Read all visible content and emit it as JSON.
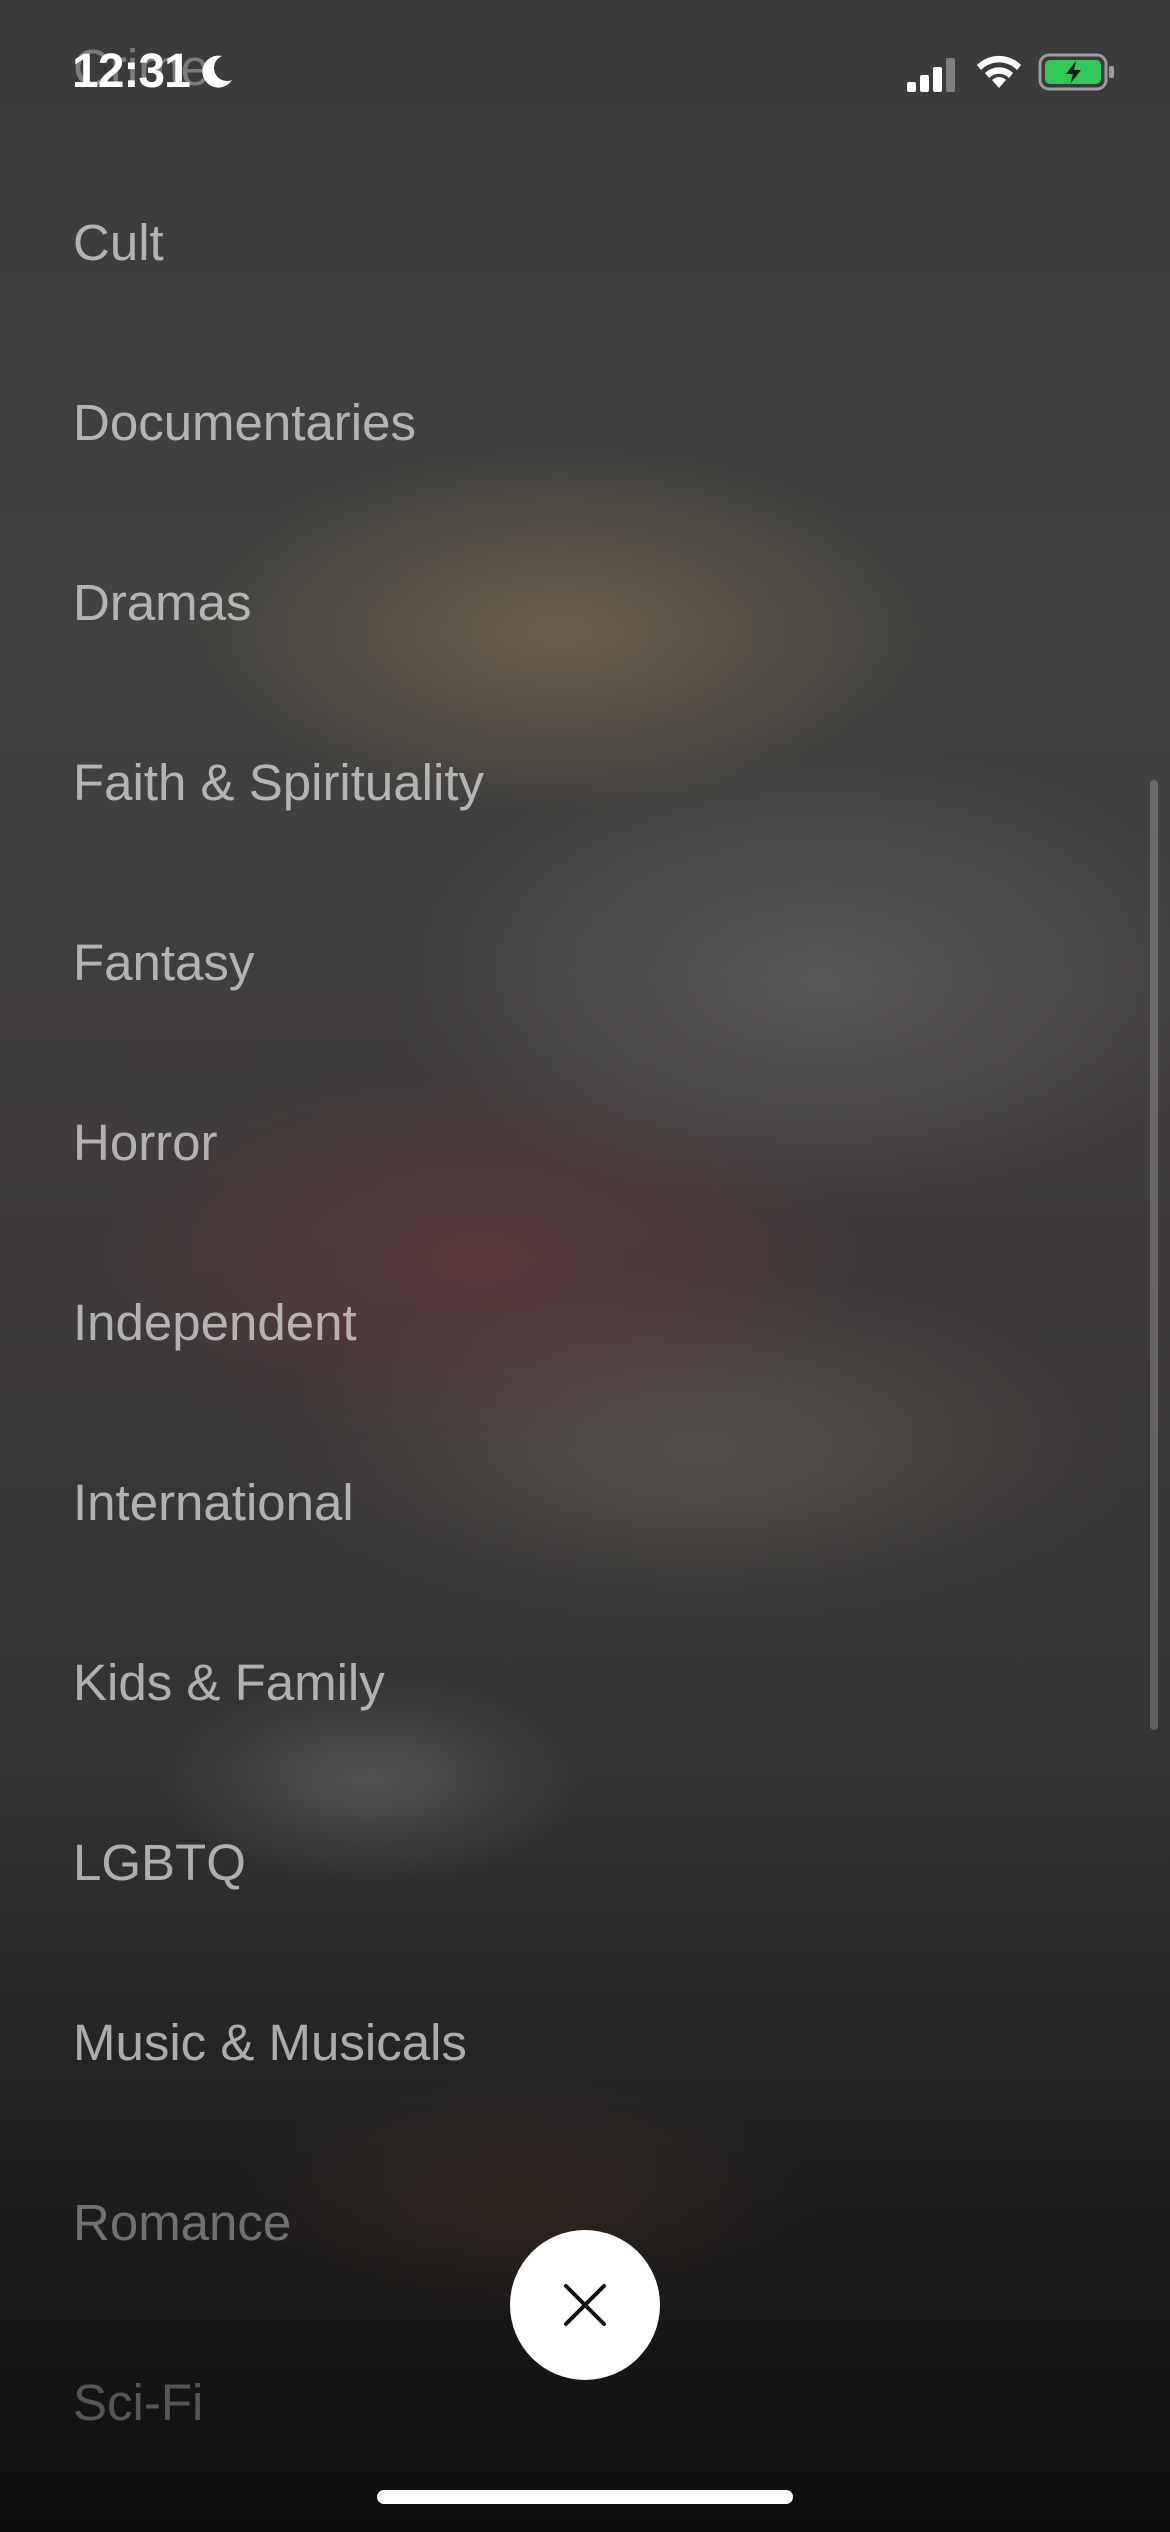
{
  "status_bar": {
    "time": "12:31",
    "icons": [
      "moon-icon",
      "cellular-signal-icon",
      "wifi-icon",
      "battery-charging-icon"
    ],
    "battery_color": "#34c759"
  },
  "genres": [
    "Crime",
    "Cult",
    "Documentaries",
    "Dramas",
    "Faith & Spirituality",
    "Fantasy",
    "Horror",
    "Independent",
    "International",
    "Kids & Family",
    "LGBTQ",
    "Music & Musicals",
    "Romance",
    "Sci-Fi"
  ],
  "close_button": {
    "icon": "close-icon"
  }
}
